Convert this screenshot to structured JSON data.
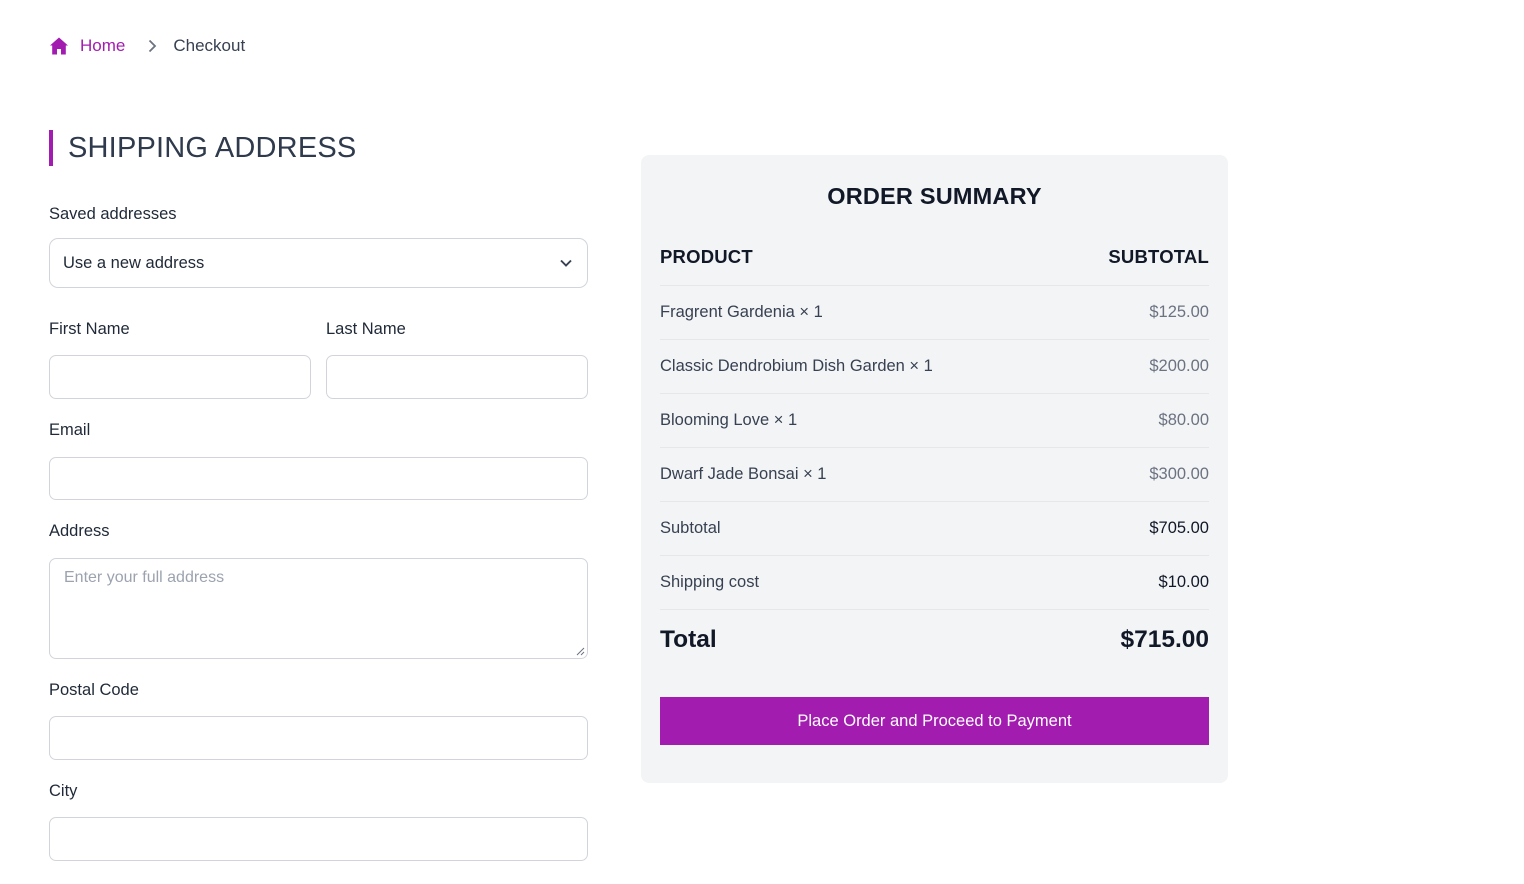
{
  "breadcrumb": {
    "home": "Home",
    "current": "Checkout"
  },
  "shipping": {
    "title": "SHIPPING ADDRESS",
    "saved_label": "Saved addresses",
    "saved_value": "Use a new address",
    "first_name_label": "First Name",
    "last_name_label": "Last Name",
    "email_label": "Email",
    "address_label": "Address",
    "address_placeholder": "Enter your full address",
    "postal_label": "Postal Code",
    "city_label": "City"
  },
  "summary": {
    "title": "ORDER SUMMARY",
    "col_product": "PRODUCT",
    "col_subtotal": "SUBTOTAL",
    "items": [
      {
        "name": "Fragrent Gardenia × 1",
        "price": "$125.00"
      },
      {
        "name": "Classic Dendrobium Dish Garden × 1",
        "price": "$200.00"
      },
      {
        "name": "Blooming Love × 1",
        "price": "$80.00"
      },
      {
        "name": "Dwarf Jade Bonsai × 1",
        "price": "$300.00"
      }
    ],
    "subtotal_label": "Subtotal",
    "subtotal_value": "$705.00",
    "shipping_label": "Shipping cost",
    "shipping_value": "$10.00",
    "total_label": "Total",
    "total_value": "$715.00",
    "button": "Place Order and Proceed to Payment"
  },
  "colors": {
    "accent": "#a21caf",
    "panel": "#f3f4f6",
    "border": "#d1d5db"
  },
  "icons": {
    "home": "home-icon",
    "separator": "chevron-right-icon",
    "select": "chevron-down-icon"
  }
}
